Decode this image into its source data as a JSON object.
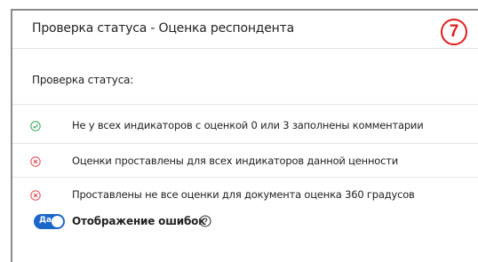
{
  "header": {
    "title": "Проверка статуса - Оценка респондента",
    "badge": "7"
  },
  "section": {
    "label": "Проверка статуса:"
  },
  "checks": [
    {
      "status": "ok",
      "icon": "check-circle-icon",
      "text": "Не у всех индикаторов с оценкой 0 или 3 заполнены комментарии"
    },
    {
      "status": "error",
      "icon": "x-circle-icon",
      "text": "Оценки проставлены для всех индикаторов данной ценности"
    },
    {
      "status": "error",
      "icon": "x-circle-icon",
      "text": "Проставлены не все оценки для документа оценка 360 градусов"
    }
  ],
  "toggle": {
    "state_label": "Да",
    "label": "Отображение ошибок",
    "help_icon": "question-circle-icon"
  },
  "colors": {
    "ok": "#2fa84f",
    "error": "#e0474c",
    "accent": "#1a66c9",
    "badge": "#e11d1d"
  }
}
